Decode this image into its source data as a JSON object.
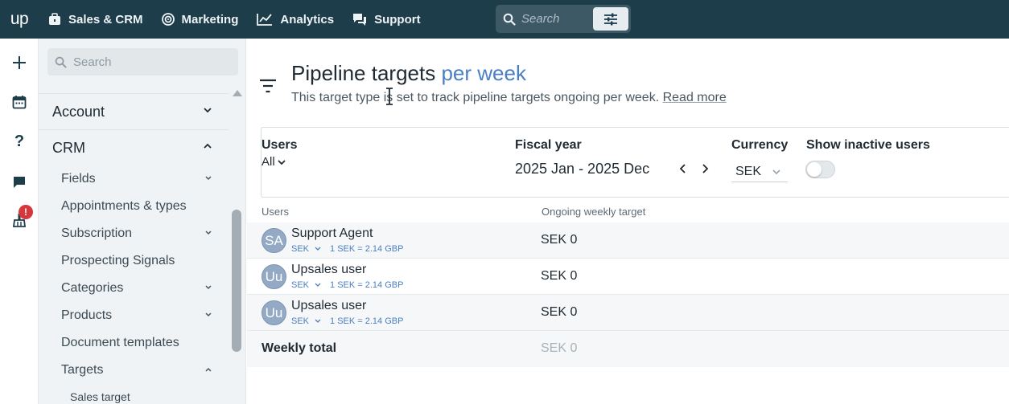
{
  "topnav": {
    "logo": "up",
    "items": [
      {
        "label": "Sales & CRM",
        "icon": "briefcase-icon"
      },
      {
        "label": "Marketing",
        "icon": "target-icon"
      },
      {
        "label": "Analytics",
        "icon": "line-chart-icon"
      },
      {
        "label": "Support",
        "icon": "chat-bubbles-icon"
      }
    ],
    "search": {
      "placeholder": "Search"
    }
  },
  "rail": {
    "icons": [
      "plus-icon",
      "calendar-icon",
      "help-icon",
      "chat-icon",
      "broom-icon"
    ],
    "alert_badge": "!"
  },
  "sidebar": {
    "search_placeholder": "Search",
    "sections": [
      {
        "label": "Account",
        "expanded": false
      },
      {
        "label": "CRM",
        "expanded": true
      }
    ],
    "crm_items": [
      {
        "label": "Fields",
        "has_chevron": true
      },
      {
        "label": "Appointments & types",
        "has_chevron": false
      },
      {
        "label": "Subscription",
        "has_chevron": true
      },
      {
        "label": "Prospecting Signals",
        "has_chevron": false
      },
      {
        "label": "Categories",
        "has_chevron": true
      },
      {
        "label": "Products",
        "has_chevron": true
      },
      {
        "label": "Document templates",
        "has_chevron": false
      },
      {
        "label": "Targets",
        "has_chevron": true
      }
    ],
    "targets_items": [
      {
        "label": "Sales target"
      }
    ]
  },
  "main": {
    "title": "Pipeline targets",
    "title_accent": "per week",
    "description": "This target type is set to track pipeline targets ongoing per week.",
    "read_more": "Read more",
    "filters": {
      "users_label": "Users",
      "users_value": "All",
      "fiscal_year_label": "Fiscal year",
      "fiscal_year_value": "2025 Jan - 2025 Dec",
      "currency_label": "Currency",
      "currency_value": "SEK",
      "inactive_label": "Show inactive users",
      "inactive_on": false
    },
    "table": {
      "columns": [
        "Users",
        "Ongoing weekly target"
      ],
      "rows": [
        {
          "initials": "SA",
          "name": "Support Agent",
          "currency": "SEK",
          "rate": "1 SEK = 2.14 GBP",
          "target": "SEK 0"
        },
        {
          "initials": "Uu",
          "name": "Upsales user",
          "currency": "SEK",
          "rate": "1 SEK = 2.14 GBP",
          "target": "SEK 0"
        },
        {
          "initials": "Uu",
          "name": "Upsales user",
          "currency": "SEK",
          "rate": "1 SEK = 2.14 GBP",
          "target": "SEK 0"
        }
      ],
      "total_label": "Weekly total",
      "total_value": "SEK 0"
    }
  }
}
